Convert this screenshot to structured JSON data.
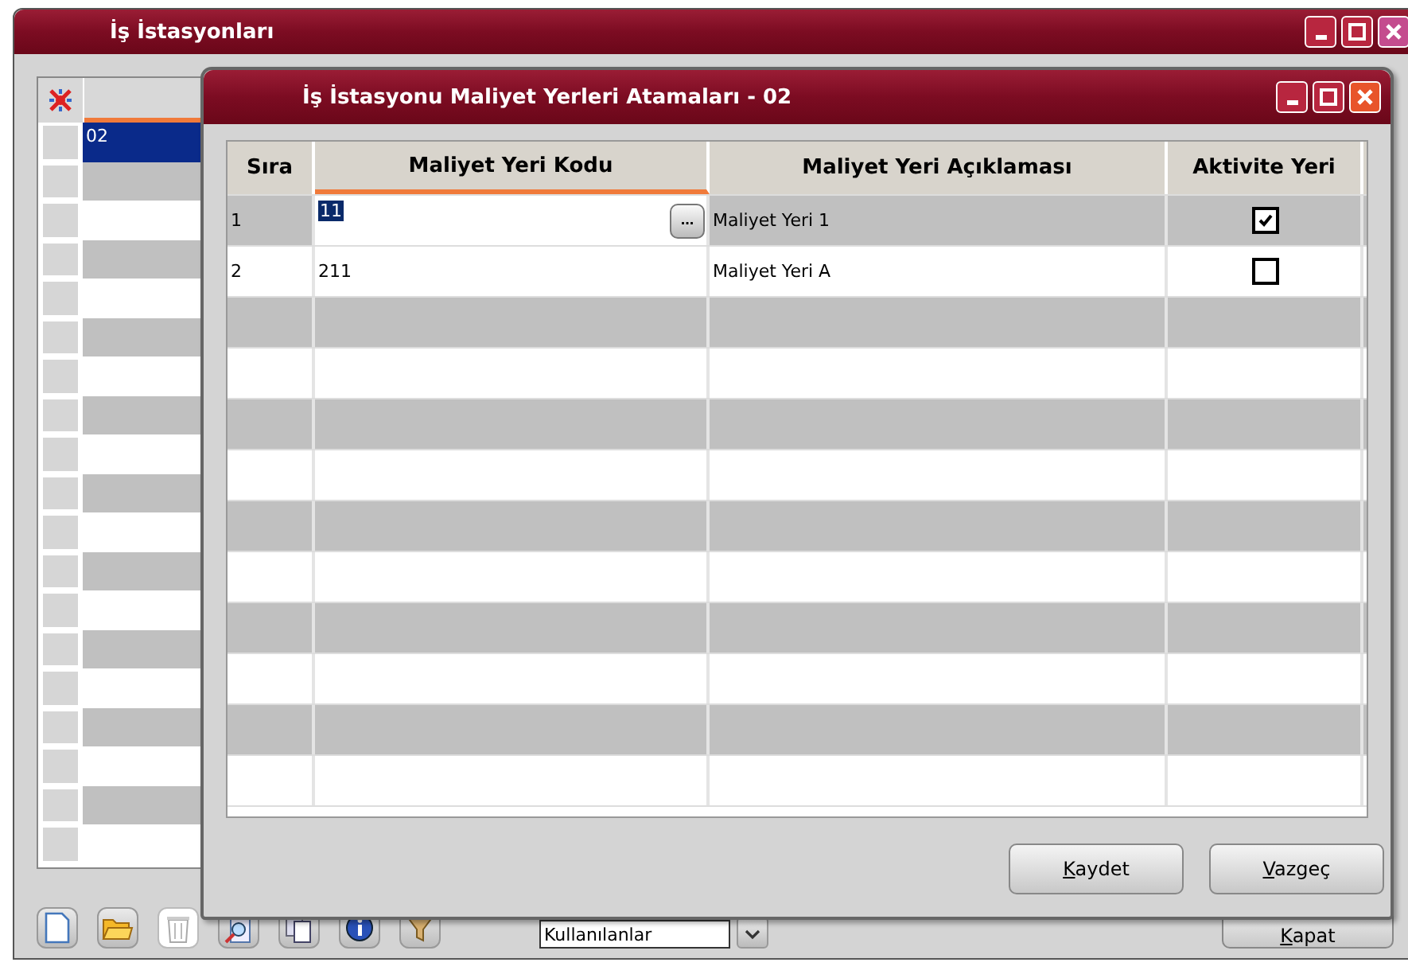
{
  "main_window": {
    "title": "İş İstasyonları",
    "grid": {
      "rows": [
        {
          "cell": "02",
          "selected": true
        }
      ]
    },
    "toolbar": [
      {
        "kind": "new",
        "disabled": false
      },
      {
        "kind": "open",
        "disabled": false
      },
      {
        "kind": "delete",
        "disabled": true
      },
      {
        "kind": "find",
        "disabled": false
      },
      {
        "kind": "copy",
        "disabled": false
      },
      {
        "kind": "info",
        "disabled": false
      },
      {
        "kind": "filter",
        "disabled": false
      }
    ],
    "filter": {
      "value": "Kullanılanlar"
    },
    "buttons": [
      {
        "label": "Kapat",
        "mnemonic": true
      }
    ]
  },
  "dialog": {
    "title": "İş İstasyonu Maliyet Yerleri Atamaları - 02",
    "table": {
      "columns": [
        {
          "label": "Sıra",
          "sorted": false
        },
        {
          "label": "Maliyet Yeri Kodu",
          "sorted": true
        },
        {
          "label": "Maliyet Yeri Açıklaması",
          "sorted": false
        },
        {
          "label": "Aktivite Yeri",
          "sorted": false
        }
      ],
      "rows": [
        {
          "sira": "1",
          "kod": "11",
          "aciklama": "Maliyet Yeri 1",
          "aktivite": true,
          "editing": true,
          "lookup": "..."
        },
        {
          "sira": "2",
          "kod": "211",
          "aciklama": "Maliyet Yeri A",
          "aktivite": false,
          "editing": false
        }
      ]
    },
    "buttons": [
      {
        "label": "Kaydet",
        "mnemonic": true
      },
      {
        "label": "Vazgeç",
        "mnemonic": true
      }
    ]
  }
}
